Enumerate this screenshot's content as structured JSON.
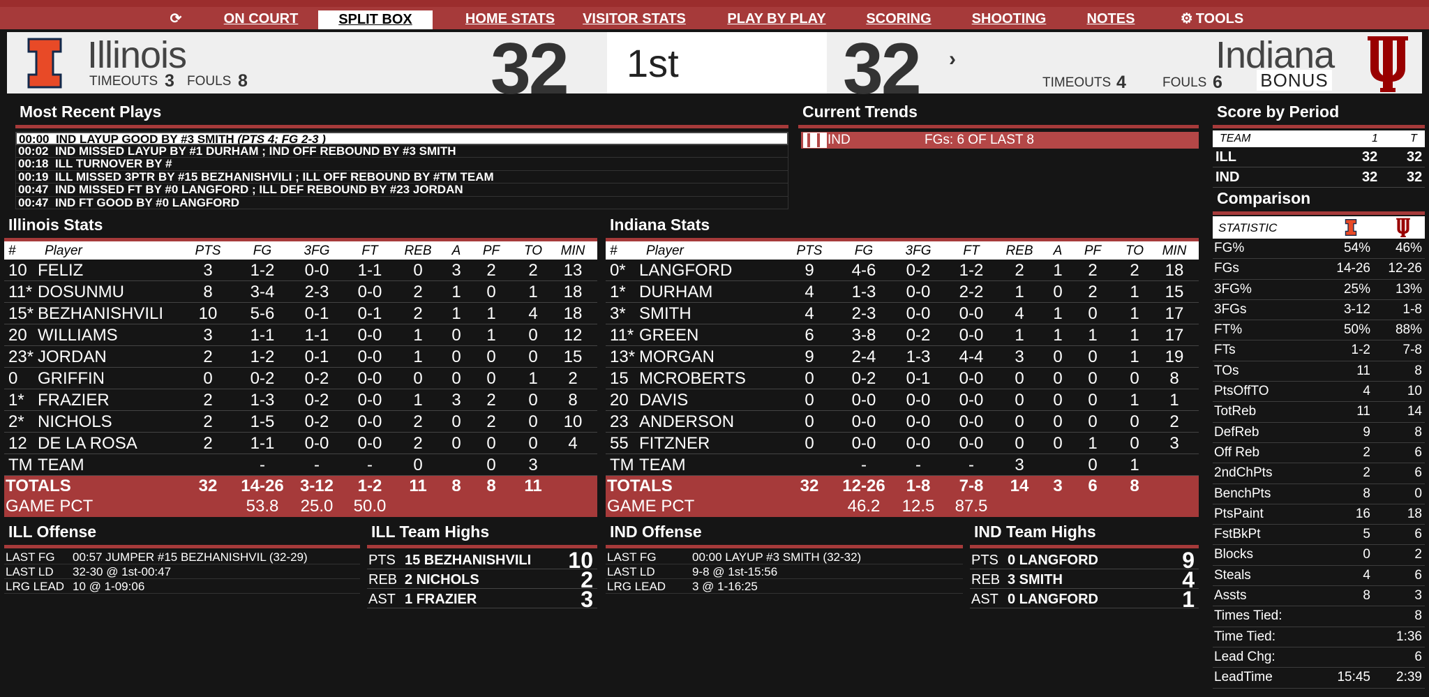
{
  "nav": {
    "refresh_icon": "refresh-icon",
    "tabs": [
      {
        "label": "ON COURT",
        "active": false
      },
      {
        "label": "SPLIT BOX",
        "active": true
      },
      {
        "label": "HOME STATS",
        "active": false
      },
      {
        "label": "VISITOR STATS",
        "active": false
      },
      {
        "label": "PLAY BY PLAY",
        "active": false
      },
      {
        "label": "SCORING",
        "active": false
      },
      {
        "label": "SHOOTING",
        "active": false
      },
      {
        "label": "NOTES",
        "active": false
      },
      {
        "label": "TOOLS",
        "active": false
      }
    ]
  },
  "scoreboard": {
    "home": {
      "name": "Illinois",
      "score": "32",
      "timeouts_label": "TIMEOUTS",
      "timeouts": "3",
      "fouls_label": "FOULS",
      "fouls": "8",
      "color": "#e84a27"
    },
    "away": {
      "name": "Indiana",
      "score": "32",
      "timeouts_label": "TIMEOUTS",
      "timeouts": "4",
      "fouls_label": "FOULS",
      "fouls": "6",
      "bonus": "BONUS",
      "color": "#990000"
    },
    "period": "1st",
    "possession_arrow": "›"
  },
  "recent_plays": {
    "title": "Most Recent Plays",
    "rows": [
      {
        "time": "00:00",
        "text": "IND LAYUP GOOD BY #3 SMITH",
        "extra": "(PTS 4; FG 2-3 )"
      },
      {
        "time": "00:02",
        "text": "IND MISSED LAYUP BY #1 DURHAM ;  IND OFF REBOUND BY #3 SMITH",
        "extra": ""
      },
      {
        "time": "00:18",
        "text": "ILL TURNOVER BY #",
        "extra": ""
      },
      {
        "time": "00:19",
        "text": "ILL MISSED 3PTR BY #15 BEZHANISHVILI ;  ILL OFF REBOUND BY #TM TEAM",
        "extra": ""
      },
      {
        "time": "00:47",
        "text": "IND MISSED FT BY #0 LANGFORD ;  ILL DEF REBOUND BY #23 JORDAN",
        "extra": ""
      },
      {
        "time": "00:47",
        "text": "IND FT GOOD BY #0 LANGFORD",
        "extra": ""
      }
    ]
  },
  "trends": {
    "title": "Current Trends",
    "team": "IND",
    "text": "FGs: 6 OF LAST 8"
  },
  "score_by_period": {
    "title": "Score by Period",
    "headers": [
      "TEAM",
      "1",
      "T"
    ],
    "rows": [
      [
        "ILL",
        "32",
        "32"
      ],
      [
        "IND",
        "32",
        "32"
      ]
    ]
  },
  "comparison": {
    "title": "Comparison",
    "header": "STATISTIC",
    "rows": [
      [
        "FG%",
        "54%",
        "46%"
      ],
      [
        "FGs",
        "14-26",
        "12-26"
      ],
      [
        "3FG%",
        "25%",
        "13%"
      ],
      [
        "3FGs",
        "3-12",
        "1-8"
      ],
      [
        "FT%",
        "50%",
        "88%"
      ],
      [
        "FTs",
        "1-2",
        "7-8"
      ],
      [
        "TOs",
        "11",
        "8"
      ],
      [
        "PtsOffTO",
        "4",
        "10"
      ],
      [
        "TotReb",
        "11",
        "14"
      ],
      [
        "DefReb",
        "9",
        "8"
      ],
      [
        "Off Reb",
        "2",
        "6"
      ],
      [
        "2ndChPts",
        "2",
        "6"
      ],
      [
        "BenchPts",
        "8",
        "0"
      ],
      [
        "PtsPaint",
        "16",
        "18"
      ],
      [
        "FstBkPt",
        "5",
        "6"
      ],
      [
        "Blocks",
        "0",
        "2"
      ],
      [
        "Steals",
        "4",
        "6"
      ],
      [
        "Assts",
        "8",
        "3"
      ],
      [
        "Times Tied:",
        "",
        "8"
      ],
      [
        "Time Tied:",
        "",
        "1:36"
      ],
      [
        "Lead Chg:",
        "",
        "6"
      ],
      [
        "LeadTime",
        "15:45",
        "2:39"
      ]
    ]
  },
  "stat_headers": [
    "#",
    "Player",
    "PTS",
    "FG",
    "3FG",
    "FT",
    "REB",
    "A",
    "PF",
    "TO",
    "MIN"
  ],
  "illinois_stats": {
    "title": "Illinois Stats",
    "players": [
      [
        "10",
        "FELIZ",
        "3",
        "1-2",
        "0-0",
        "1-1",
        "0",
        "3",
        "2",
        "2",
        "13"
      ],
      [
        "11*",
        "DOSUNMU",
        "8",
        "3-4",
        "2-3",
        "0-0",
        "2",
        "1",
        "0",
        "1",
        "18"
      ],
      [
        "15*",
        "BEZHANISHVILI",
        "10",
        "5-6",
        "0-1",
        "0-1",
        "2",
        "1",
        "1",
        "4",
        "18"
      ],
      [
        "20",
        "WILLIAMS",
        "3",
        "1-1",
        "1-1",
        "0-0",
        "1",
        "0",
        "1",
        "0",
        "12"
      ],
      [
        "23*",
        "JORDAN",
        "2",
        "1-2",
        "0-1",
        "0-0",
        "1",
        "0",
        "0",
        "0",
        "15"
      ],
      [
        "0",
        "GRIFFIN",
        "0",
        "0-2",
        "0-2",
        "0-0",
        "0",
        "0",
        "0",
        "1",
        "2"
      ],
      [
        "1*",
        "FRAZIER",
        "2",
        "1-3",
        "0-2",
        "0-0",
        "1",
        "3",
        "2",
        "0",
        "8"
      ],
      [
        "2*",
        "NICHOLS",
        "2",
        "1-5",
        "0-2",
        "0-0",
        "2",
        "0",
        "2",
        "0",
        "10"
      ],
      [
        "12",
        "DE LA ROSA",
        "2",
        "1-1",
        "0-0",
        "0-0",
        "2",
        "0",
        "0",
        "0",
        "4"
      ],
      [
        "TM",
        "TEAM",
        "",
        "-",
        "-",
        "-",
        "0",
        "",
        "0",
        "3",
        ""
      ]
    ],
    "totals": [
      "TOTALS",
      "32",
      "14-26",
      "3-12",
      "1-2",
      "11",
      "8",
      "8",
      "11"
    ],
    "game_pct": [
      "GAME PCT",
      "53.8",
      "25.0",
      "50.0"
    ]
  },
  "indiana_stats": {
    "title": "Indiana Stats",
    "players": [
      [
        "0*",
        "LANGFORD",
        "9",
        "4-6",
        "0-2",
        "1-2",
        "2",
        "1",
        "2",
        "2",
        "18"
      ],
      [
        "1*",
        "DURHAM",
        "4",
        "1-3",
        "0-0",
        "2-2",
        "1",
        "0",
        "2",
        "1",
        "15"
      ],
      [
        "3*",
        "SMITH",
        "4",
        "2-3",
        "0-0",
        "0-0",
        "4",
        "1",
        "0",
        "1",
        "17"
      ],
      [
        "11*",
        "GREEN",
        "6",
        "3-8",
        "0-2",
        "0-0",
        "1",
        "1",
        "1",
        "1",
        "17"
      ],
      [
        "13*",
        "MORGAN",
        "9",
        "2-4",
        "1-3",
        "4-4",
        "3",
        "0",
        "0",
        "1",
        "19"
      ],
      [
        "15",
        "MCROBERTS",
        "0",
        "0-2",
        "0-1",
        "0-0",
        "0",
        "0",
        "0",
        "0",
        "8"
      ],
      [
        "20",
        "DAVIS",
        "0",
        "0-0",
        "0-0",
        "0-0",
        "0",
        "0",
        "0",
        "1",
        "1"
      ],
      [
        "23",
        "ANDERSON",
        "0",
        "0-0",
        "0-0",
        "0-0",
        "0",
        "0",
        "0",
        "0",
        "2"
      ],
      [
        "55",
        "FITZNER",
        "0",
        "0-0",
        "0-0",
        "0-0",
        "0",
        "0",
        "1",
        "0",
        "3"
      ],
      [
        "TM",
        "TEAM",
        "",
        "-",
        "-",
        "-",
        "3",
        "",
        "0",
        "1",
        ""
      ]
    ],
    "totals": [
      "TOTALS",
      "32",
      "12-26",
      "1-8",
      "7-8",
      "14",
      "3",
      "6",
      "8"
    ],
    "game_pct": [
      "GAME PCT",
      "46.2",
      "12.5",
      "87.5"
    ]
  },
  "ill_offense": {
    "title": "ILL Offense",
    "rows": [
      [
        "LAST FG",
        "00:57 JUMPER #15 BEZHANISHVIL (32-29)"
      ],
      [
        "LAST LD",
        "32-30 @ 1st-00:47"
      ],
      [
        "LRG LEAD",
        "10 @ 1-09:06"
      ]
    ]
  },
  "ill_highs": {
    "title": "ILL Team Highs",
    "rows": [
      [
        "PTS",
        "15 BEZHANISHVILI",
        "10"
      ],
      [
        "REB",
        "2 NICHOLS",
        "2"
      ],
      [
        "AST",
        "1 FRAZIER",
        "3"
      ]
    ]
  },
  "ind_offense": {
    "title": "IND Offense",
    "rows": [
      [
        "LAST FG",
        "00:00 LAYUP #3 SMITH (32-32)"
      ],
      [
        "LAST LD",
        "9-8 @ 1st-15:56"
      ],
      [
        "LRG LEAD",
        "3 @ 1-16:25"
      ]
    ]
  },
  "ind_highs": {
    "title": "IND Team Highs",
    "rows": [
      [
        "PTS",
        "0 LANGFORD",
        "9"
      ],
      [
        "REB",
        "3 SMITH",
        "4"
      ],
      [
        "AST",
        "0 LANGFORD",
        "1"
      ]
    ]
  }
}
